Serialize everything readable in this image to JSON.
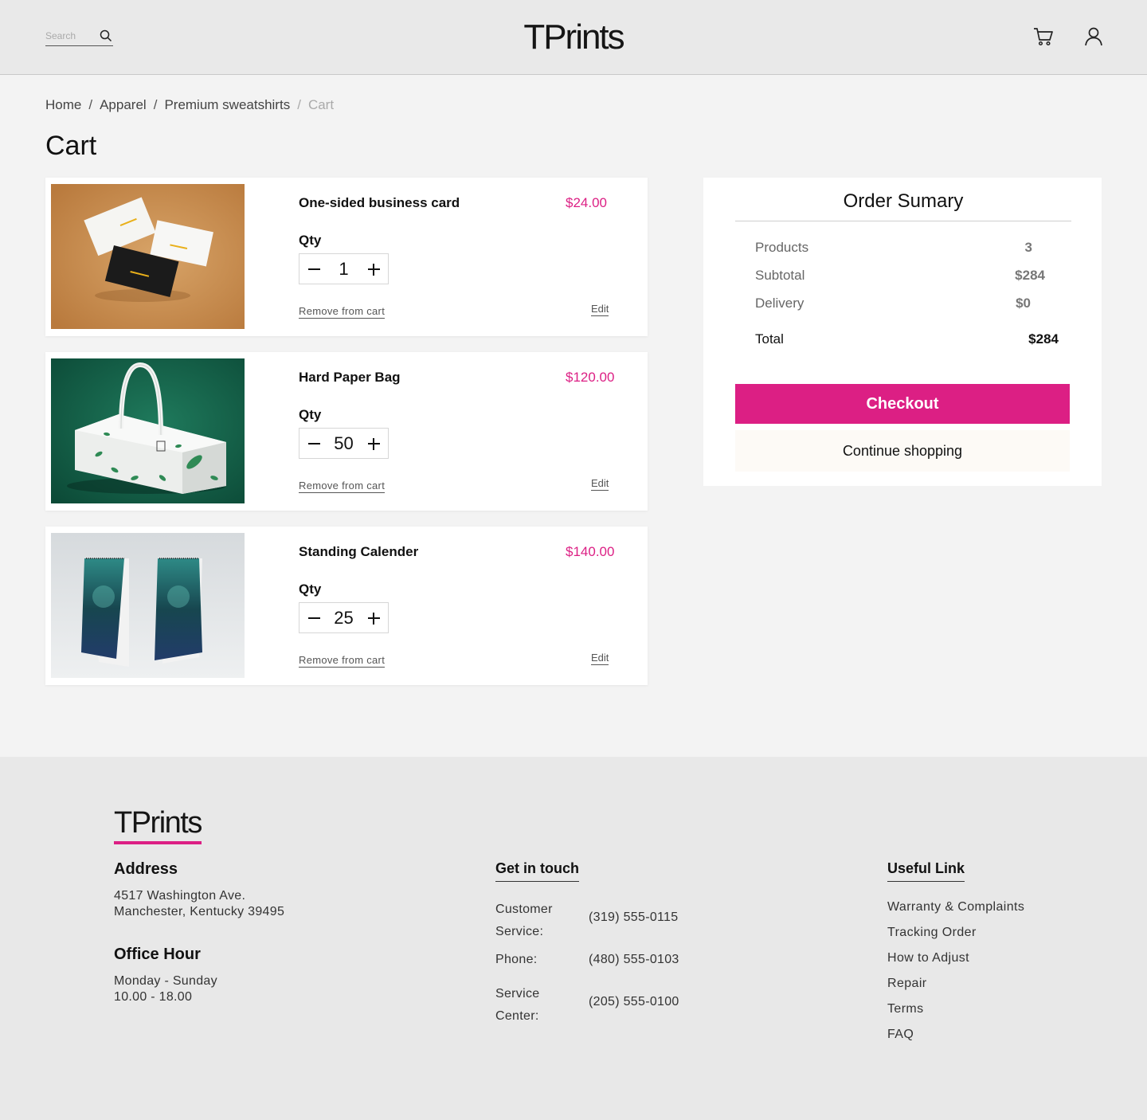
{
  "header": {
    "search_placeholder": "Search",
    "logo": "TPrints",
    "icons": [
      "search-icon",
      "cart-icon",
      "user-icon"
    ]
  },
  "breadcrumb": [
    "Home",
    "Apparel",
    "Premium sweatshirts",
    "Cart"
  ],
  "page_title": "Cart",
  "cart": {
    "qty_label": "Qty",
    "remove_label": "Remove from cart",
    "edit_label": "Edit",
    "items": [
      {
        "name": "One-sided business card",
        "price": "$24.00",
        "qty": "1"
      },
      {
        "name": "Hard Paper Bag",
        "price": "$120.00",
        "qty": "50"
      },
      {
        "name": "Standing Calender",
        "price": "$140.00",
        "qty": "25"
      }
    ]
  },
  "summary": {
    "title": "Order Sumary",
    "rows": [
      {
        "label": "Products",
        "value": "3"
      },
      {
        "label": "Subtotal",
        "value": "$284"
      },
      {
        "label": "Delivery",
        "value": "$0"
      }
    ],
    "total_label": "Total",
    "total_value": "$284",
    "checkout_label": "Checkout",
    "continue_label": "Continue shopping"
  },
  "footer": {
    "logo": "TPrints",
    "address_heading": "Address",
    "address_line1": "4517 Washington Ave.",
    "address_line2": "Manchester, Kentucky 39495",
    "office_heading": "Office Hour",
    "office_line1": "Monday - Sunday",
    "office_line2": "10.00 - 18.00",
    "contact_heading": "Get in touch",
    "contacts": [
      {
        "label_line1": "Customer",
        "label_line2": "Service:",
        "value": "(319) 555-0115"
      },
      {
        "label_line1": "Phone:",
        "label_line2": "",
        "value": "(480) 555-0103"
      },
      {
        "label_line1": "Service",
        "label_line2": "Center:",
        "value": "(205) 555-0100"
      }
    ],
    "links_heading": "Useful Link",
    "links": [
      "Warranty & Complaints",
      "Tracking Order",
      "How to Adjust",
      "Repair",
      "Terms",
      "FAQ"
    ]
  },
  "colors": {
    "accent": "#dc1f84",
    "page_bg": "#f3f3f3",
    "header_bg": "#e9e9e9",
    "footer_bg": "#e8e8e8"
  }
}
